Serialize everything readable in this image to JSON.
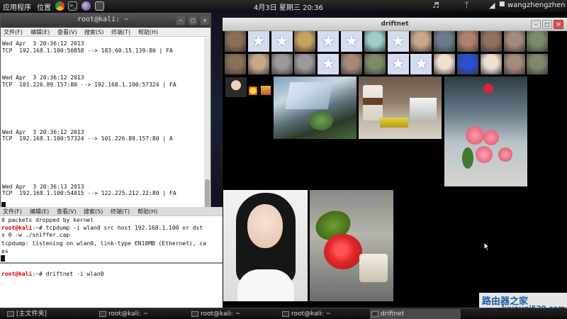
{
  "top_panel": {
    "applications": "应用程序",
    "places": "位置",
    "clock": "4月3日 星期三 20:36",
    "user": "wangzhengzhen",
    "launchers": [
      "chrome-icon",
      "terminal-icon",
      "iceweasel-icon",
      "screenshot-icon"
    ],
    "tray_icons": [
      "volume-icon",
      "bluetooth-icon",
      "network-icon",
      "user-icon"
    ]
  },
  "terminal_top": {
    "title": "root@kali: ~",
    "menu": [
      "文件(F)",
      "编辑(E)",
      "查看(V)",
      "搜索(S)",
      "终端(T)",
      "帮助(H)"
    ],
    "lines": [
      "Wed Apr  3 20:36:12 2013",
      "TCP  192.168.1.100:50858 --> 183.60.15.139:80 | FA",
      "",
      "",
      "",
      "Wed Apr  3 20:36:12 2013",
      "TCP  101.226.89.157:80 --> 192.168.1.100:57324 | FA",
      "",
      "",
      "",
      "",
      "",
      "",
      "Wed Apr  3 20:36:12 2013",
      "TCP  192.168.1.100:57324 --> 101.226.89.157:80 | A",
      "",
      "",
      "",
      "",
      "",
      "",
      "Wed Apr  3 20:36:13 2013",
      "TCP  192.168.1.100:54015 --> 122.225.212.22:80 | FA"
    ]
  },
  "terminal_middle": {
    "menu": [
      "文件(F)",
      "编辑(E)",
      "查看(V)",
      "搜索(S)",
      "终端(T)",
      "帮助(H)"
    ],
    "line1": "0 packets dropped by kernel",
    "prompt": "root@kali",
    "prompt_rest": ":~# tcpdump -i wlan0 src host 192.168.1.100 or dst",
    "line3": "s 0 -w ./sniffer.cap",
    "line4": "tcpdump: listening on wlan0, link-type EN10MB (Ethernet), ca",
    "line5": "es"
  },
  "terminal_bottom": {
    "prompt": "root@kali",
    "prompt_rest": ":~# driftnet -i wlan0"
  },
  "driftnet": {
    "title": "driftnet",
    "thumbnails_row1": [
      "photo-thumb",
      "star-placeholder",
      "star-placeholder",
      "avatar-thumb",
      "star-placeholder",
      "star-placeholder",
      "anime-thumb",
      "star-placeholder",
      "photo-thumb",
      "photo-thumb",
      "photo-thumb",
      "photo-thumb",
      "photo-thumb",
      "photo-thumb"
    ],
    "thumbnails_row2": [
      "photo-thumb",
      "photo-thumb",
      "gray-thumb",
      "gray-thumb",
      "star-placeholder",
      "photo-thumb",
      "photo-thumb",
      "star-placeholder",
      "star-placeholder",
      "cartoon-thumb",
      "rose-thumb",
      "cartoon-thumb",
      "photo-thumb",
      "photo-thumb"
    ],
    "images": [
      "small-portrait",
      "tiny-icon",
      "tiny-icon",
      "office-plants-photo",
      "coffee-books-photo",
      "flowers-photo",
      "girl-portrait-photo",
      "red-rose-photo"
    ]
  },
  "taskbar": {
    "items": [
      "[主文件夹]",
      "root@kali: ~",
      "root@kali: ~",
      "root@kali: ~",
      "driftnet"
    ],
    "active_index": 4
  },
  "watermark": {
    "text": "路由器之家",
    "url": "luyouqi520.com"
  }
}
